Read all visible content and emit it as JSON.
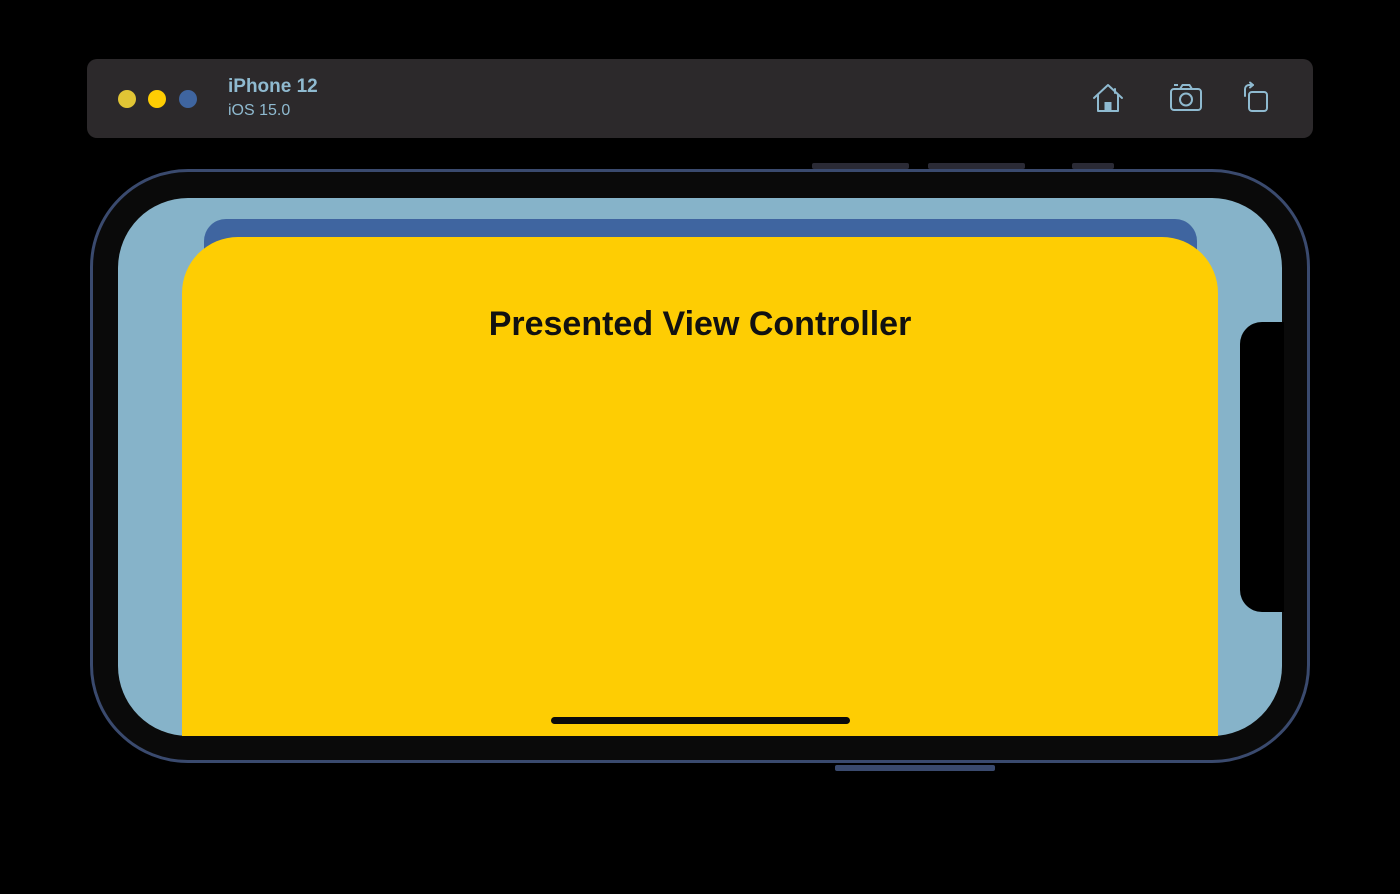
{
  "simulator": {
    "device_name": "iPhone 12",
    "os_version": "iOS 15.0",
    "traffic_lights": [
      {
        "name": "close-light",
        "color": "#e1c535"
      },
      {
        "name": "minimize-light",
        "color": "#fecd03"
      },
      {
        "name": "zoom-light",
        "color": "#3f65a0"
      }
    ],
    "toolbar": [
      {
        "name": "home-button",
        "icon": "home-icon"
      },
      {
        "name": "screenshot-button",
        "icon": "camera-icon"
      },
      {
        "name": "rotate-button",
        "icon": "rotate-icon"
      }
    ],
    "icon_color": "#8fbad0"
  },
  "screen": {
    "background_color": "#86b3c9",
    "presenting_sheet_color": "#3f65a0",
    "presented_sheet_color": "#fecd03",
    "presented_title": "Presented View Controller"
  }
}
